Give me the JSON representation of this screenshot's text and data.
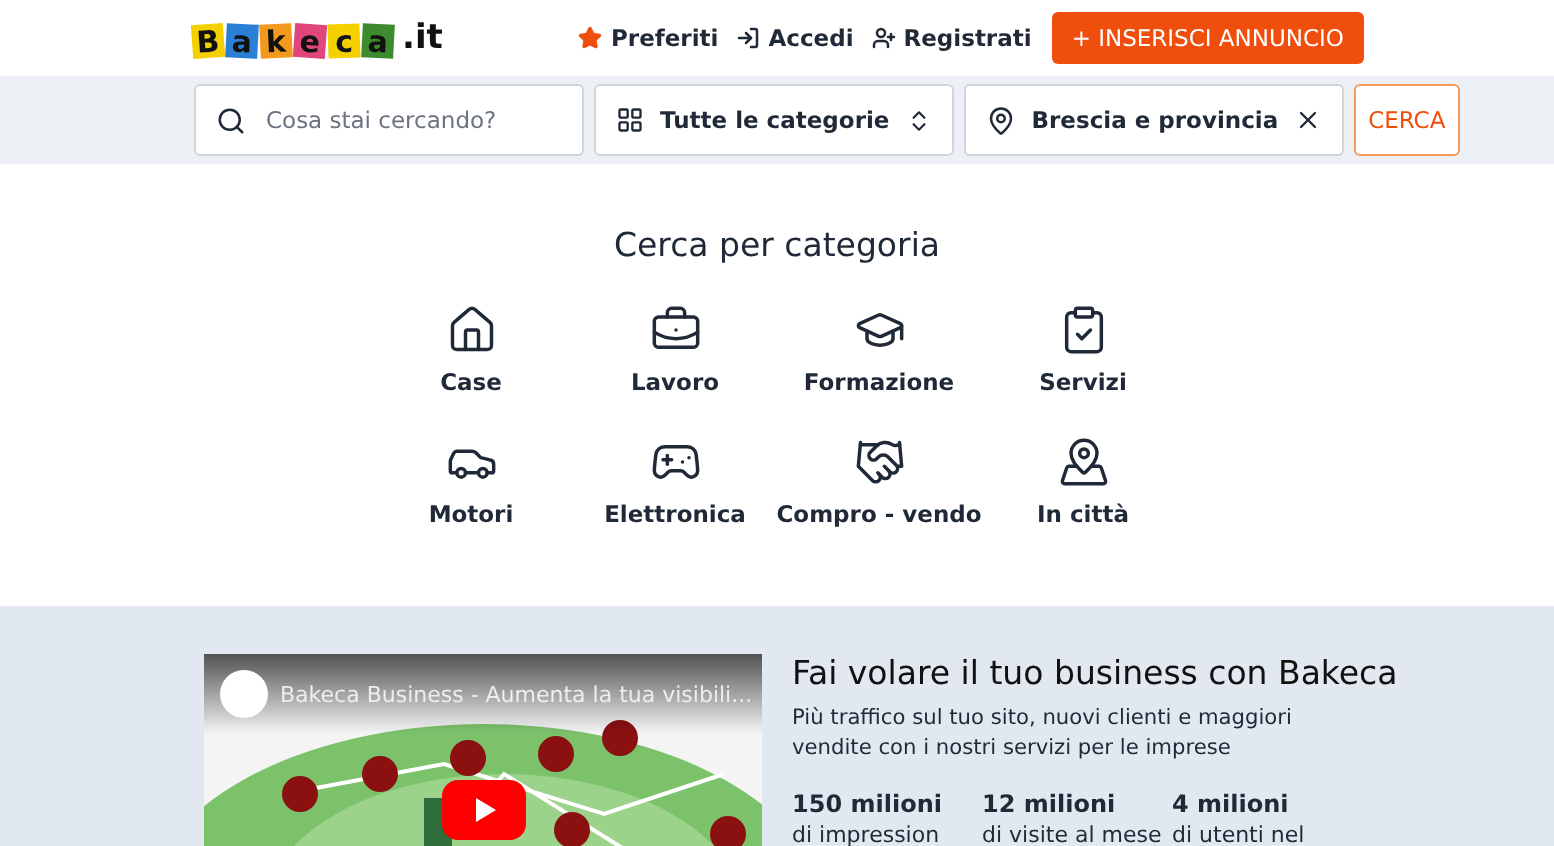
{
  "logo": {
    "letters": [
      {
        "char": "B",
        "color": "#f5d000"
      },
      {
        "char": "a",
        "color": "#2b7fd6"
      },
      {
        "char": "k",
        "color": "#f39a1e"
      },
      {
        "char": "e",
        "color": "#e0457b"
      },
      {
        "char": "c",
        "color": "#f5d000"
      },
      {
        "char": "a",
        "color": "#3d8b2e"
      }
    ],
    "suffix": ".it"
  },
  "nav": {
    "links": [
      "Preferiti",
      "Accedi",
      "Registrati"
    ],
    "cta": "+ INSERISCI ANNUNCIO"
  },
  "search": {
    "query": {
      "placeholder": "Cosa stai cercando?"
    },
    "category": {
      "value": "Tutte le categorie"
    },
    "location": {
      "value": "Brescia e provincia"
    },
    "button": "CERCA"
  },
  "categories": {
    "title": "Cerca per categoria",
    "items": [
      "Case",
      "Lavoro",
      "Formazione",
      "Servizi",
      "Motori",
      "Elettronica",
      "Compro - vendo",
      "In città"
    ]
  },
  "promo": {
    "video": {
      "kind": "picture",
      "title": "Bakeca Business - Aumenta la tua visibili..."
    },
    "title": "Fai volare il tuo business con Bakeca",
    "text": "Più traffico sul tuo sito, nuovi clienti e maggiori vendite con i nostri servizi per le imprese",
    "stats": [
      {
        "value": "150 milioni",
        "label": "di impression"
      },
      {
        "value": "12 milioni",
        "label": "di visite al mese"
      },
      {
        "value": "4 milioni",
        "label": "di utenti nel"
      }
    ]
  }
}
